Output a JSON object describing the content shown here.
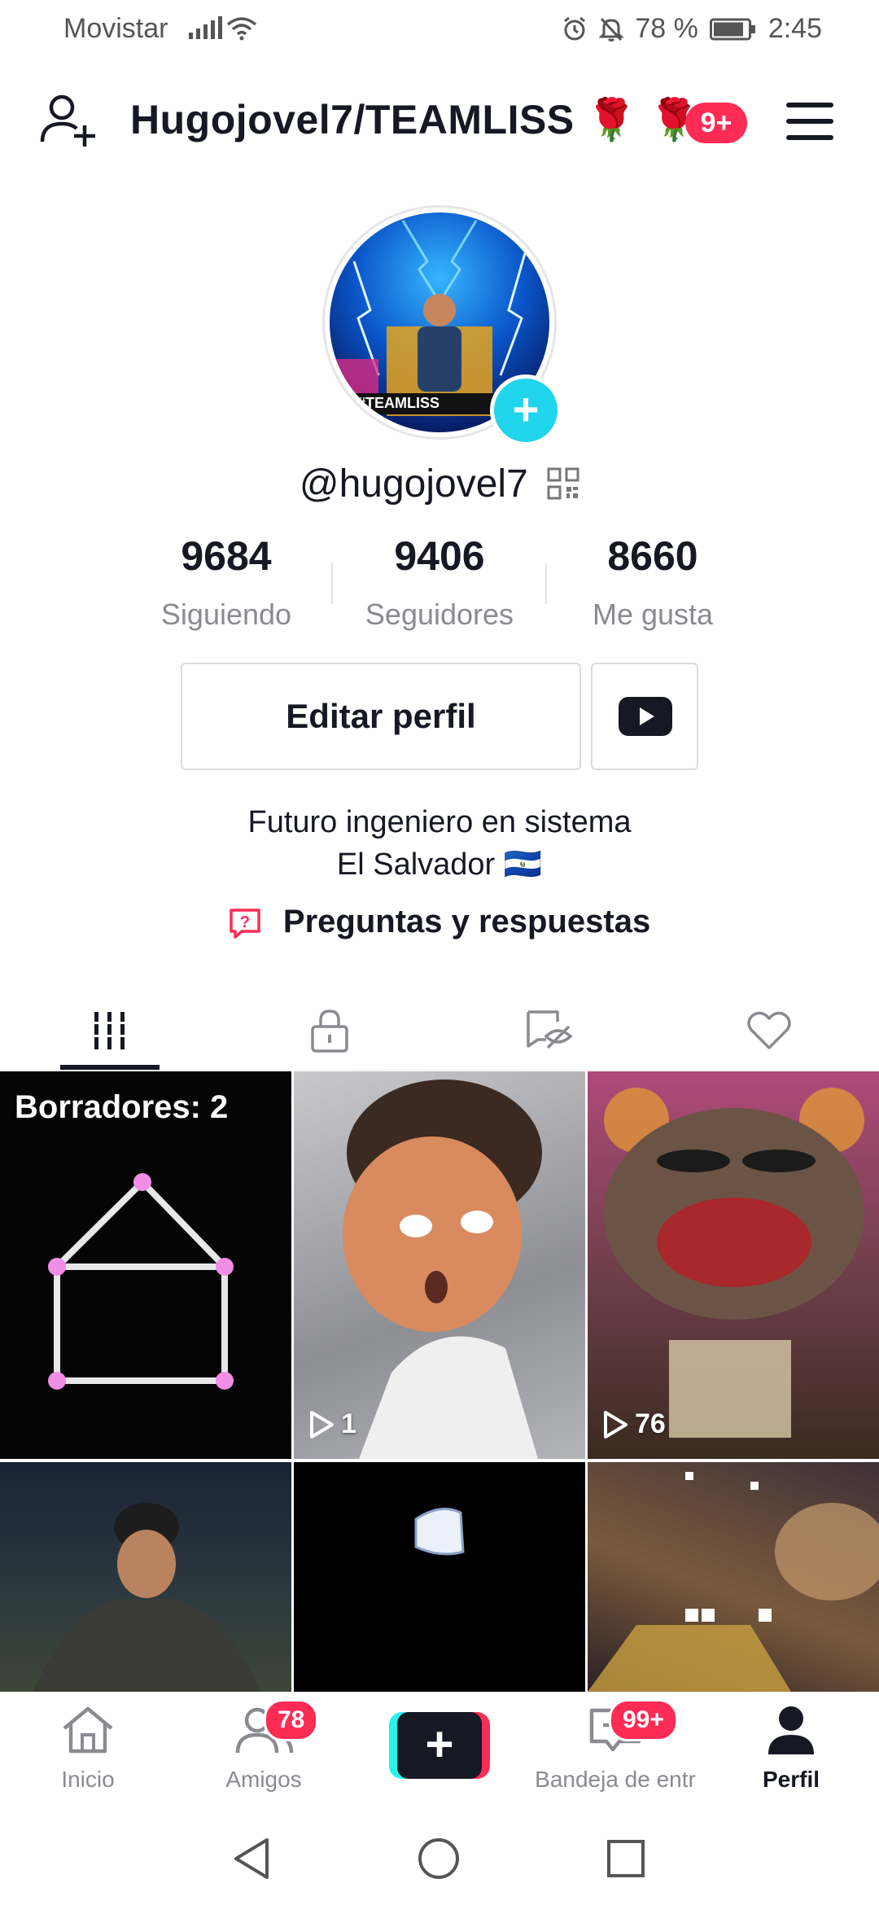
{
  "status_bar": {
    "carrier": "Movistar",
    "battery": "78 %",
    "time": "2:45"
  },
  "header": {
    "title": "Hugojovel7/TEAMLISS 🌹 🌹",
    "notification_badge": "9+"
  },
  "profile": {
    "avatar_caption": "#TEAMLISS",
    "username": "@hugojovel7",
    "stats": [
      {
        "value": "9684",
        "label": "Siguiendo"
      },
      {
        "value": "9406",
        "label": "Seguidores"
      },
      {
        "value": "8660",
        "label": "Me gusta"
      }
    ],
    "edit_button": "Editar perfil",
    "bio_line1": "Futuro ingeniero en sistema",
    "bio_line2": "El Salvador 🇸🇻",
    "qa_link": "Preguntas y respuestas"
  },
  "tabs": [
    {
      "name": "videos",
      "icon": "grid-icon",
      "active": true
    },
    {
      "name": "private",
      "icon": "lock-icon",
      "active": false
    },
    {
      "name": "hidden",
      "icon": "eye-off-icon",
      "active": false
    },
    {
      "name": "liked",
      "icon": "heart-icon",
      "active": false
    }
  ],
  "grid": {
    "drafts_label": "Borradores: 2",
    "views": [
      "1",
      "76"
    ]
  },
  "bottom_nav": {
    "items": [
      {
        "label": "Inicio",
        "icon": "home-icon"
      },
      {
        "label": "Amigos",
        "icon": "friends-icon",
        "badge": "78"
      },
      {
        "label": "",
        "icon": "create-icon"
      },
      {
        "label": "Bandeja de entr",
        "icon": "inbox-icon",
        "badge": "99+"
      },
      {
        "label": "Perfil",
        "icon": "profile-icon"
      }
    ]
  },
  "colors": {
    "accent": "#fe2c55",
    "teal": "#20d5ec",
    "text": "#161823",
    "muted": "#8a8b91"
  }
}
